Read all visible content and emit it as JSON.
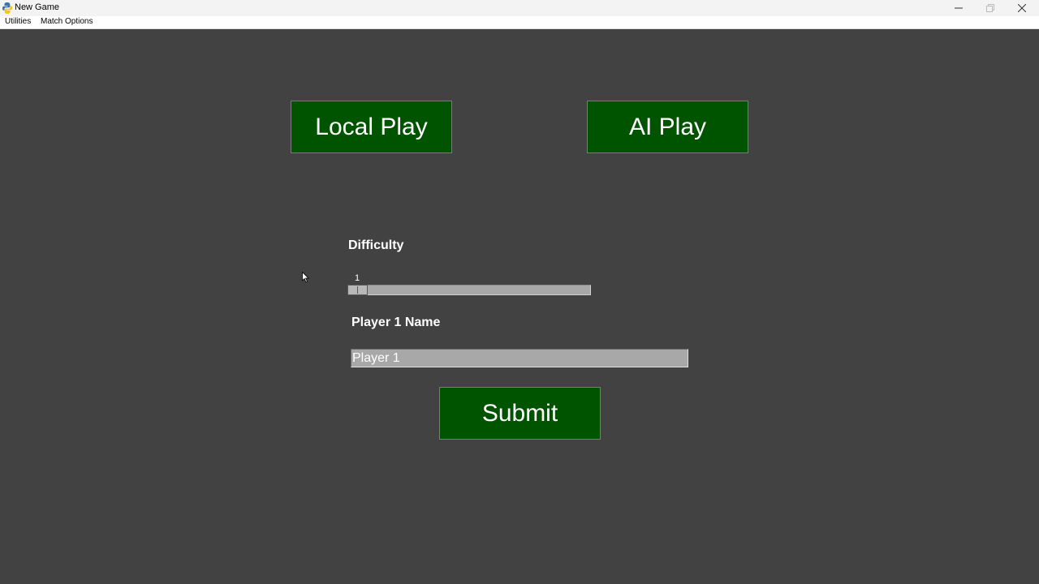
{
  "window": {
    "title": "New Game",
    "controls": [
      "minimize",
      "maximize",
      "close"
    ]
  },
  "menubar": {
    "items": [
      {
        "label": "Utilities"
      },
      {
        "label": "Match Options"
      }
    ]
  },
  "mode_buttons": {
    "local": "Local Play",
    "ai": "AI Play"
  },
  "difficulty": {
    "label": "Difficulty",
    "value": "1"
  },
  "player": {
    "label": "Player 1 Name",
    "value": "Player 1"
  },
  "submit_label": "Submit",
  "colors": {
    "background": "#424242",
    "button_green": "#005400",
    "text": "#ffffff"
  }
}
